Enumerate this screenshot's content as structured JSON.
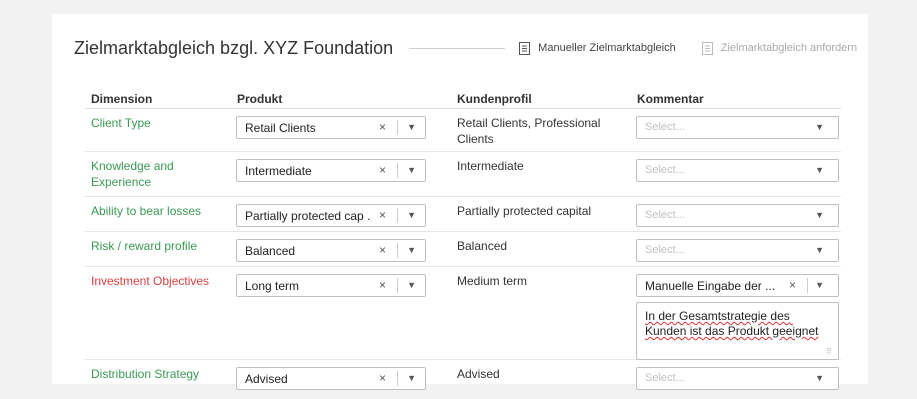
{
  "header": {
    "title": "Zielmarktabgleich bzgl. XYZ Foundation",
    "manual_button": "Manueller Zielmarktabgleich",
    "request_button": "Zielmarktabgleich anfordern"
  },
  "columns": {
    "dimension": "Dimension",
    "produkt": "Produkt",
    "kundenprofil": "Kundenprofil",
    "kommentar": "Kommentar"
  },
  "rows": [
    {
      "dimension": "Client Type",
      "produkt": "Retail Clients",
      "kundenprofil": "Retail Clients, Professional Clients",
      "kommentar_placeholder": "Select..."
    },
    {
      "dimension": "Knowledge and Experience",
      "produkt": "Intermediate",
      "kundenprofil": "Intermediate",
      "kommentar_placeholder": "Select..."
    },
    {
      "dimension": "Ability to bear losses",
      "produkt": "Partially protected cap ...",
      "kundenprofil": "Partially protected capital",
      "kommentar_placeholder": "Select..."
    },
    {
      "dimension": "Risk / reward profile",
      "produkt": "Balanced",
      "kundenprofil": "Balanced",
      "kommentar_placeholder": "Select..."
    },
    {
      "dimension": "Investment Objectives",
      "produkt": "Long term",
      "kundenprofil": "Medium term",
      "kommentar_value": "Manuelle Eingabe der ...",
      "kommentar_text": "In der Gesamtstrategie des Kunden ist das Produkt geeignet"
    },
    {
      "dimension": "Distribution Strategy",
      "produkt": "Advised",
      "kundenprofil": "Advised",
      "kommentar_placeholder": "Select..."
    }
  ],
  "glyphs": {
    "clear": "×",
    "arrow": "▼",
    "grip": "⠿"
  },
  "colors": {
    "match": "#3a9a54",
    "mismatch": "#d94040"
  }
}
